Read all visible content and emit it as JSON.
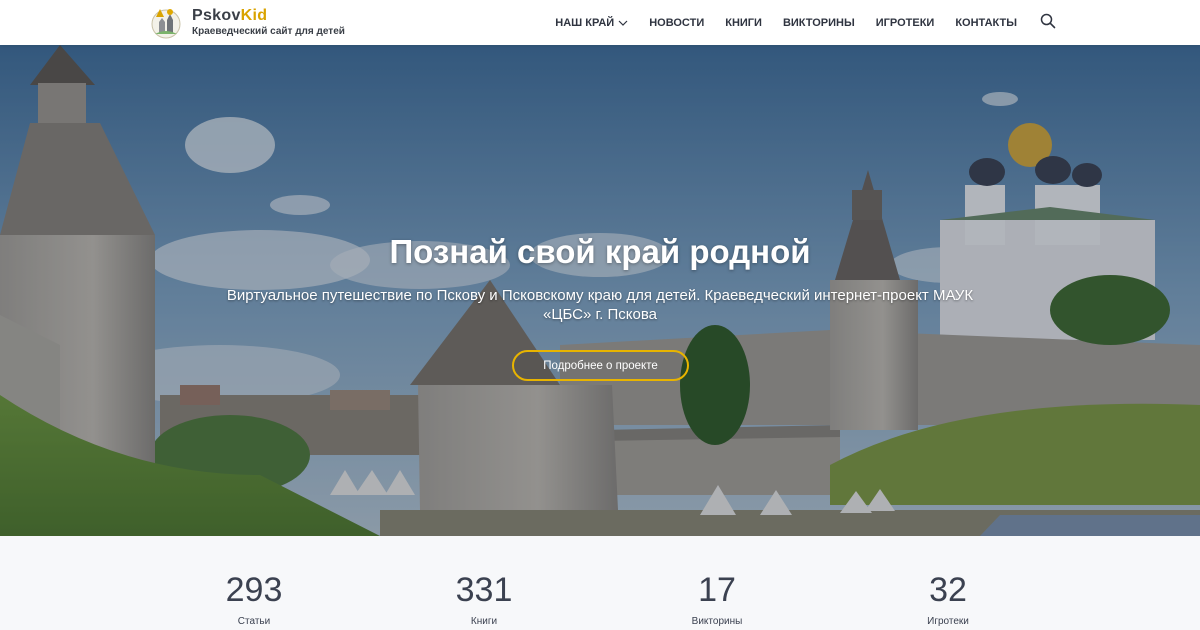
{
  "header": {
    "logo": {
      "title_part1": "Pskov",
      "title_part2": "Kid",
      "subtitle": "Краеведческий сайт для детей"
    },
    "nav": [
      {
        "label": "НАШ КРАЙ",
        "has_dropdown": true
      },
      {
        "label": "НОВОСТИ"
      },
      {
        "label": "КНИГИ"
      },
      {
        "label": "ВИКТОРИНЫ"
      },
      {
        "label": "ИГРОТЕКИ"
      },
      {
        "label": "КОНТАКТЫ"
      }
    ],
    "search_icon": "search-icon"
  },
  "hero": {
    "title": "Познай свой край родной",
    "subtitle": "Виртуальное путешествие по Пскову и Псковскому краю для детей. Краеведческий интернет-проект МАУК «ЦБС» г. Пскова",
    "button_label": "Подробнее о проекте"
  },
  "stats": [
    {
      "value": "293",
      "label": "Статьи"
    },
    {
      "value": "331",
      "label": "Книги"
    },
    {
      "value": "17",
      "label": "Викторины"
    },
    {
      "value": "32",
      "label": "Игротеки"
    }
  ],
  "colors": {
    "accent": "#e8b400",
    "brand_dark": "#3a3f47",
    "stats_bg": "#f7f8fa"
  }
}
